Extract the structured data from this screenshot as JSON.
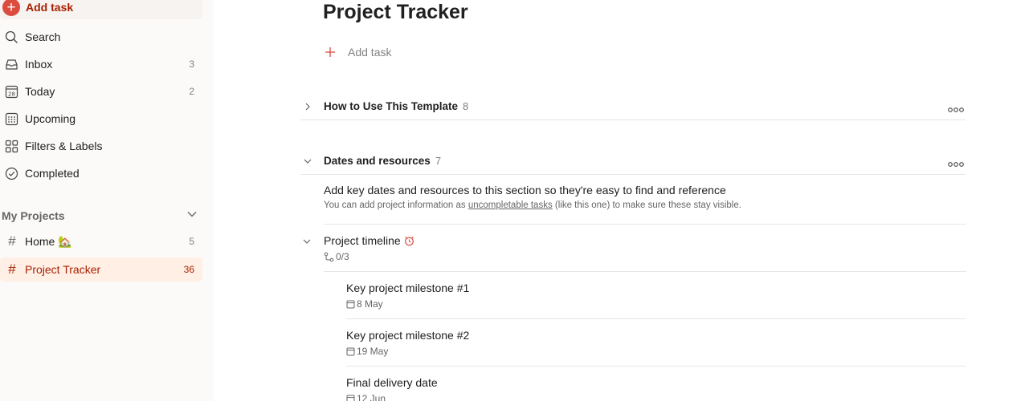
{
  "sidebar": {
    "add_task_label": "Add task",
    "nav": [
      {
        "label": "Search",
        "count": ""
      },
      {
        "label": "Inbox",
        "count": "3"
      },
      {
        "label": "Today",
        "count": "2",
        "icon_text": "28"
      },
      {
        "label": "Upcoming",
        "count": ""
      },
      {
        "label": "Filters & Labels",
        "count": ""
      },
      {
        "label": "Completed",
        "count": ""
      }
    ],
    "projects_title": "My Projects",
    "projects": [
      {
        "label": "Home 🏡",
        "count": "5"
      },
      {
        "label": "Project Tracker",
        "count": "36"
      }
    ]
  },
  "main": {
    "title": "Project Tracker",
    "add_task_label": "Add task",
    "sections": [
      {
        "name": "How to Use This Template",
        "count": "8"
      },
      {
        "name": "Dates and resources",
        "count": "7"
      }
    ],
    "tasks": {
      "resources": {
        "title": "Add key dates and resources to this section so they're easy to find and reference",
        "desc_before": "You can add project information as ",
        "desc_link": "uncompletable tasks",
        "desc_after": " (like this one) to make sure these stay visible."
      },
      "timeline": {
        "title": "Project timeline",
        "subtasks": "0/3"
      },
      "milestones": [
        {
          "title": "Key project milestone #1",
          "date": "8 May"
        },
        {
          "title": "Key project milestone #2",
          "date": "19 May"
        },
        {
          "title": "Final delivery date",
          "date": "12 Jun"
        }
      ]
    }
  },
  "colors": {
    "accent": "#dc4c3e",
    "active_text": "#a81f00",
    "active_bg": "#ffefe5",
    "sidebar_bg": "#fcfaf8"
  }
}
